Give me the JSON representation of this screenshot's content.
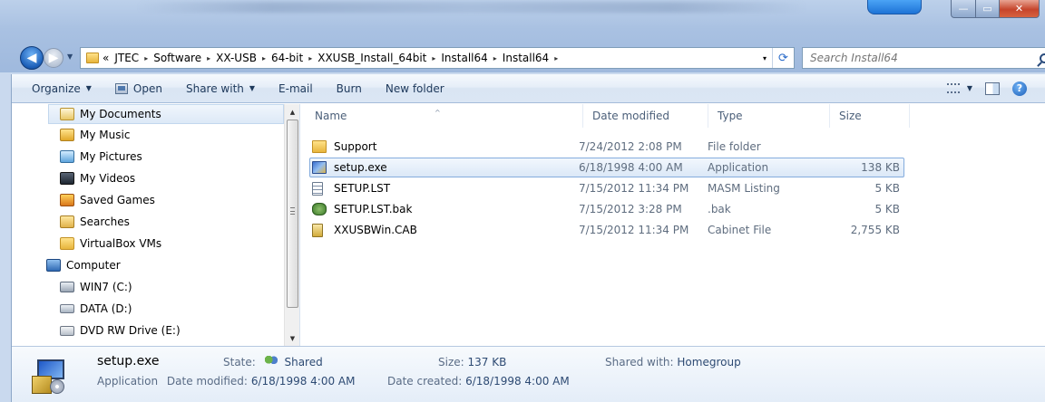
{
  "address": {
    "overflow_glyph": "«",
    "crumbs": [
      "JTEC",
      "Software",
      "XX-USB",
      "64-bit",
      "XXUSB_Install_64bit",
      "Install64",
      "Install64"
    ],
    "separator": "▸",
    "dropdown_glyph": "▾",
    "refresh_glyph": "⟳"
  },
  "search": {
    "placeholder": "Search Install64"
  },
  "nav": {
    "back_glyph": "◀",
    "forward_glyph": "▶",
    "recent_glyph": "▼"
  },
  "window_buttons": {
    "minimize": "—",
    "maximize": "▭",
    "close": "✕"
  },
  "toolbar": {
    "organize": "Organize",
    "open": "Open",
    "share_with": "Share with",
    "email": "E-mail",
    "burn": "Burn",
    "new_folder": "New folder",
    "dropdown_glyph": "▼",
    "help_glyph": "?"
  },
  "navpane": {
    "items": [
      {
        "label": "My Documents",
        "icon": "documents-icon"
      },
      {
        "label": "My Music",
        "icon": "music-icon"
      },
      {
        "label": "My Pictures",
        "icon": "pictures-icon"
      },
      {
        "label": "My Videos",
        "icon": "videos-icon"
      },
      {
        "label": "Saved Games",
        "icon": "saved-games-icon"
      },
      {
        "label": "Searches",
        "icon": "searches-icon"
      },
      {
        "label": "VirtualBox VMs",
        "icon": "folder-icon"
      },
      {
        "label": "Computer",
        "icon": "computer-icon"
      },
      {
        "label": "WIN7 (C:)",
        "icon": "drive-c-icon"
      },
      {
        "label": "DATA (D:)",
        "icon": "drive-d-icon"
      },
      {
        "label": "DVD RW Drive (E:)",
        "icon": "dvd-drive-icon"
      }
    ],
    "scroll_up_glyph": "▲",
    "scroll_down_glyph": "▼"
  },
  "columns": {
    "name": "Name",
    "date": "Date modified",
    "type": "Type",
    "size": "Size",
    "sort_glyph": "^"
  },
  "files": [
    {
      "name": "Support",
      "date": "7/24/2012 2:08 PM",
      "type": "File folder",
      "size": "",
      "icon": "folder-icon"
    },
    {
      "name": "setup.exe",
      "date": "6/18/1998 4:00 AM",
      "type": "Application",
      "size": "138 KB",
      "icon": "installer-icon",
      "selected": true
    },
    {
      "name": "SETUP.LST",
      "date": "7/15/2012 11:34 PM",
      "type": "MASM Listing",
      "size": "5 KB",
      "icon": "text-file-icon"
    },
    {
      "name": "SETUP.LST.bak",
      "date": "7/15/2012 3:28 PM",
      "type": ".bak",
      "size": "5 KB",
      "icon": "bak-file-icon"
    },
    {
      "name": "XXUSBWin.CAB",
      "date": "7/15/2012 11:34 PM",
      "type": "Cabinet File",
      "size": "2,755 KB",
      "icon": "cabinet-file-icon"
    }
  ],
  "details": {
    "name": "setup.exe",
    "kind": "Application",
    "date_modified_label": "Date modified:",
    "date_modified": "6/18/1998 4:00 AM",
    "state_label": "State:",
    "state": "Shared",
    "size_label": "Size:",
    "size": "137 KB",
    "date_created_label": "Date created:",
    "date_created": "6/18/1998 4:00 AM",
    "shared_with_label": "Shared with:",
    "shared_with": "Homegroup"
  }
}
